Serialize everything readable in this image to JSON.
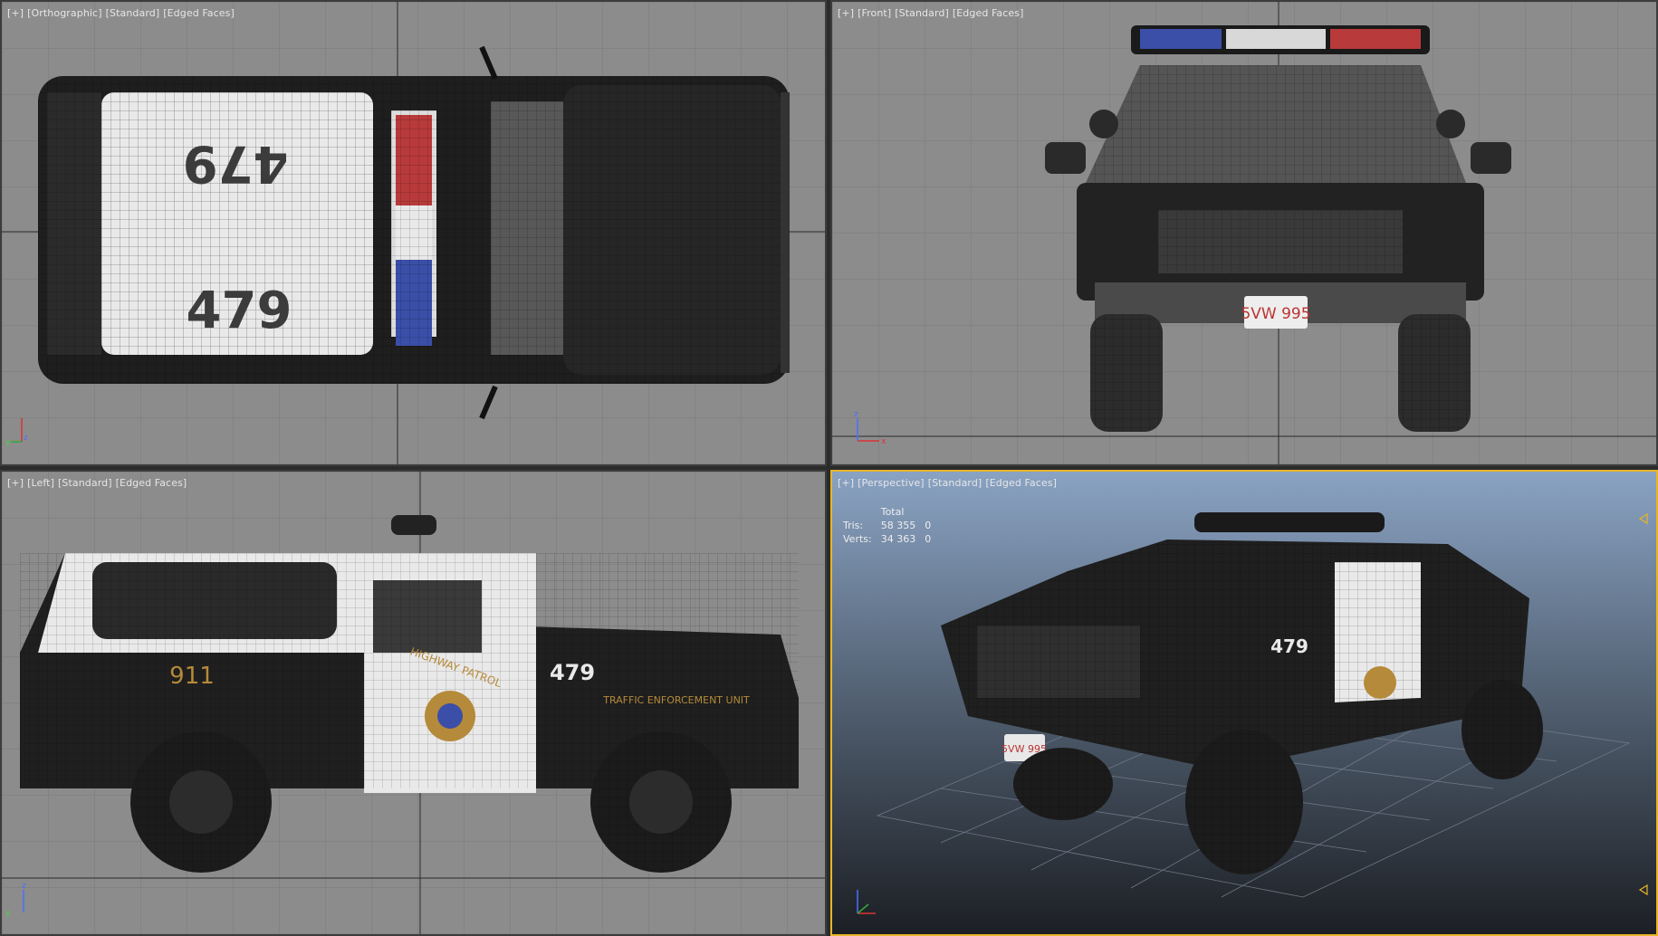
{
  "viewports": {
    "top": {
      "labels": [
        "[+]",
        "[Orthographic]",
        "[Standard]",
        "[Edged Faces]"
      ]
    },
    "front": {
      "labels": [
        "[+]",
        "[Front]",
        "[Standard]",
        "[Edged Faces]"
      ]
    },
    "left": {
      "labels": [
        "[+]",
        "[Left]",
        "[Standard]",
        "[Edged Faces]"
      ]
    },
    "perspective": {
      "labels": [
        "[+]",
        "[Perspective]",
        "[Standard]",
        "[Edged Faces]"
      ]
    }
  },
  "vehicle": {
    "unit_number": "479",
    "side_number": "911",
    "plate": "5VW 995",
    "door_text": "HIGHWAY PATROL",
    "side_text": "TRAFFIC ENFORCEMENT UNIT"
  },
  "stats": {
    "header": "Total",
    "rows": [
      {
        "label": "Tris:",
        "total": "58 355",
        "sel": "0"
      },
      {
        "label": "Verts:",
        "total": "34 363",
        "sel": "0"
      }
    ]
  },
  "axes": {
    "x": "x",
    "y": "y",
    "z": "z"
  },
  "colors": {
    "viewport_bg": "#8c8c8c",
    "grid": "#7b7b7b",
    "persp_top": "#8aa3c3",
    "persp_bottom": "#1c1f24",
    "active_border": "#e8b52a",
    "body_black": "#1e1e1e",
    "body_white": "#e9e9e9",
    "lightbar_red": "#b83a3a",
    "lightbar_blue": "#3b4ea8",
    "gold_text": "#b58a3a"
  }
}
